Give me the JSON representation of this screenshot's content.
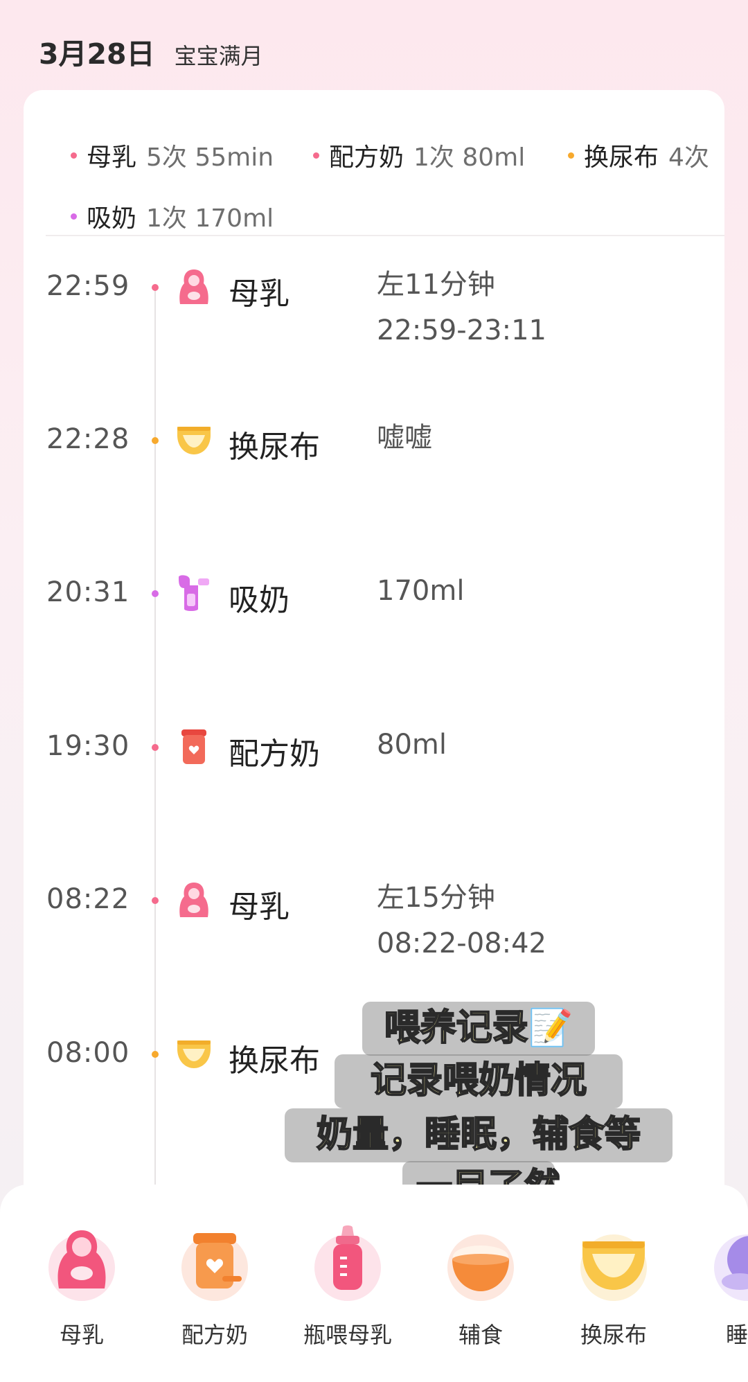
{
  "header": {
    "date": "3月28日",
    "milestone": "宝宝满月"
  },
  "summary": [
    {
      "label": "母乳",
      "value": "5次 55min",
      "color": "#f56b8d"
    },
    {
      "label": "配方奶",
      "value": "1次 80ml",
      "color": "#f56b8d"
    },
    {
      "label": "换尿布",
      "value": "4次",
      "color": "#f7a92d"
    },
    {
      "label": "吸奶",
      "value": "1次 170ml",
      "color": "#d86be6"
    }
  ],
  "timeline": [
    {
      "time": "22:59",
      "type": "母乳",
      "icon": "breastfeed-icon",
      "detail1": "左11分钟",
      "detail2": "22:59-23:11",
      "dot_color": "#f56b8d"
    },
    {
      "time": "22:28",
      "type": "换尿布",
      "icon": "diaper-icon",
      "detail1": "嘘嘘",
      "detail2": "",
      "dot_color": "#f7a92d"
    },
    {
      "time": "20:31",
      "type": "吸奶",
      "icon": "breast-pump-icon",
      "detail1": "170ml",
      "detail2": "",
      "dot_color": "#d86be6"
    },
    {
      "time": "19:30",
      "type": "配方奶",
      "icon": "formula-can-icon",
      "detail1": "80ml",
      "detail2": "",
      "dot_color": "#f56b8d"
    },
    {
      "time": "08:22",
      "type": "母乳",
      "icon": "breastfeed-icon",
      "detail1": "左15分钟",
      "detail2": "08:22-08:42",
      "dot_color": "#f56b8d"
    },
    {
      "time": "08:00",
      "type": "换尿布",
      "icon": "diaper-icon",
      "detail1": "",
      "detail2": "",
      "dot_color": "#f7a92d"
    }
  ],
  "overlay_caption": [
    "喂养记录📝",
    "记录喂奶情况",
    "奶量，睡眠，辅食等",
    "一目了然"
  ],
  "toolbar": [
    {
      "label": "母乳",
      "icon": "breastfeed-icon"
    },
    {
      "label": "配方奶",
      "icon": "formula-can-icon"
    },
    {
      "label": "瓶喂母乳",
      "icon": "baby-bottle-icon"
    },
    {
      "label": "辅食",
      "icon": "baby-food-bowl-icon"
    },
    {
      "label": "换尿布",
      "icon": "diaper-icon"
    },
    {
      "label": "睡",
      "icon": "sleep-icon"
    }
  ]
}
